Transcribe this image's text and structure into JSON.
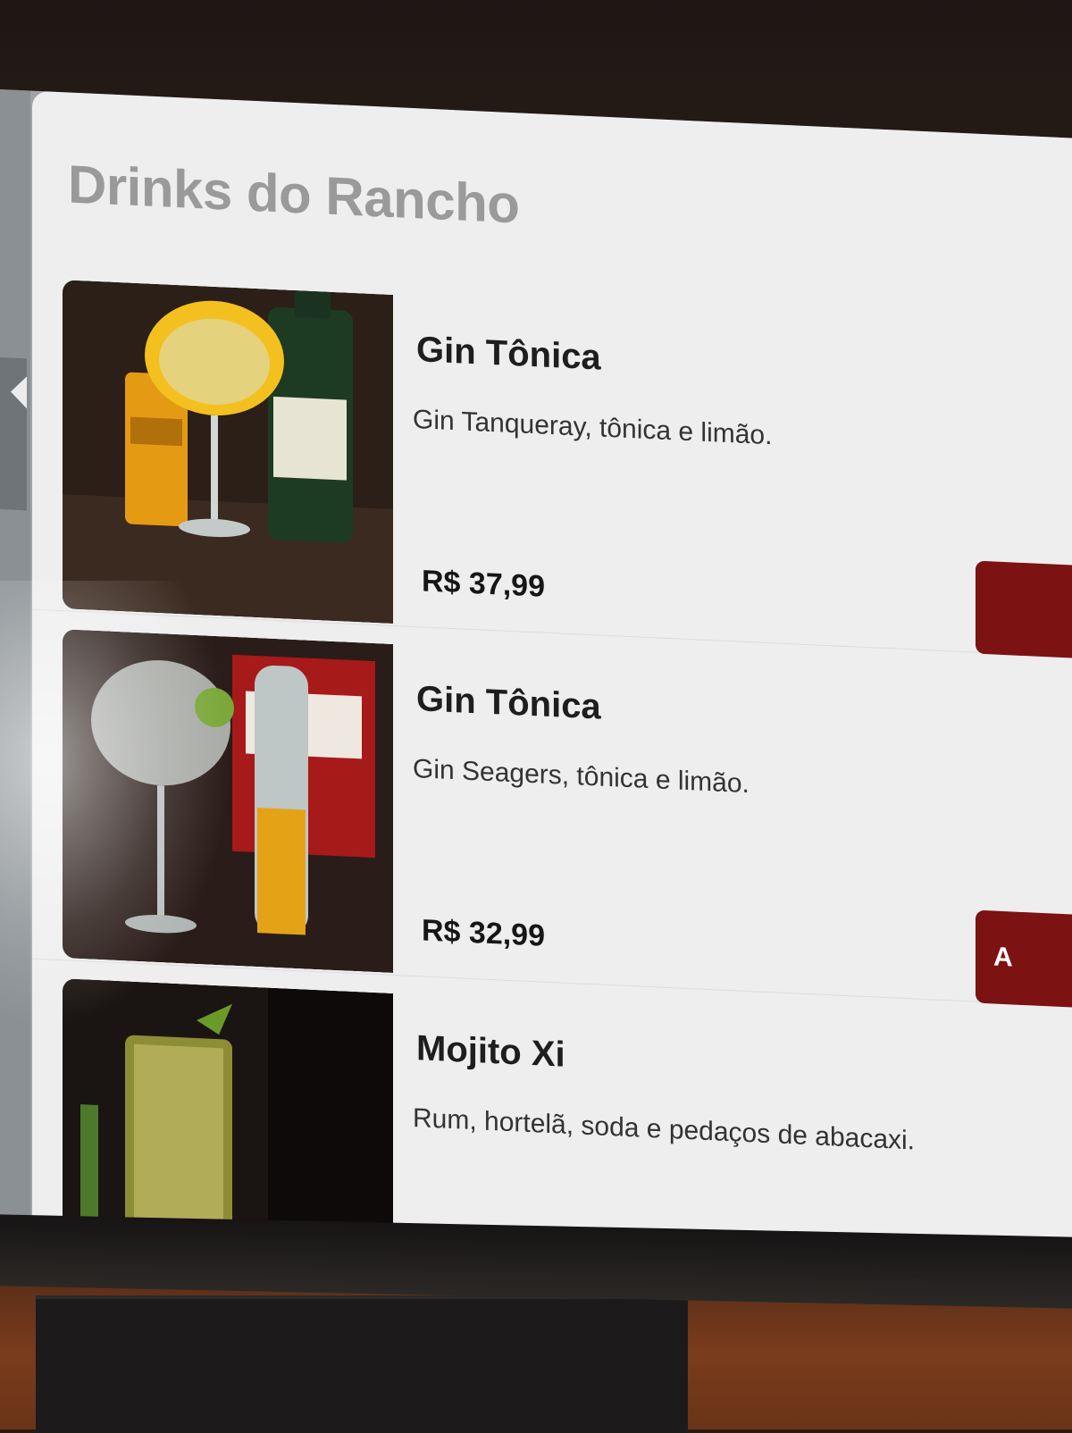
{
  "panel": {
    "title": "Drinks do Rancho"
  },
  "items": [
    {
      "name": "Gin Tônica",
      "description": "Gin Tanqueray, tônica e limão.",
      "price": "R$ 37,99",
      "image_icon": "gin-tonic-photo"
    },
    {
      "name": "Gin Tônica",
      "description": "Gin Seagers, tônica e limão.",
      "price": "R$ 32,99",
      "add_label": "A",
      "image_icon": "gin-tonic-photo"
    },
    {
      "name": "Mojito Xi",
      "description": "Rum, hortelã, soda e pedaços de abacaxi.",
      "image_icon": "mojito-photo"
    }
  ],
  "colors": {
    "accent": "#7c1212",
    "panel_bg": "#eeeeee",
    "title": "#9a9a9a"
  }
}
